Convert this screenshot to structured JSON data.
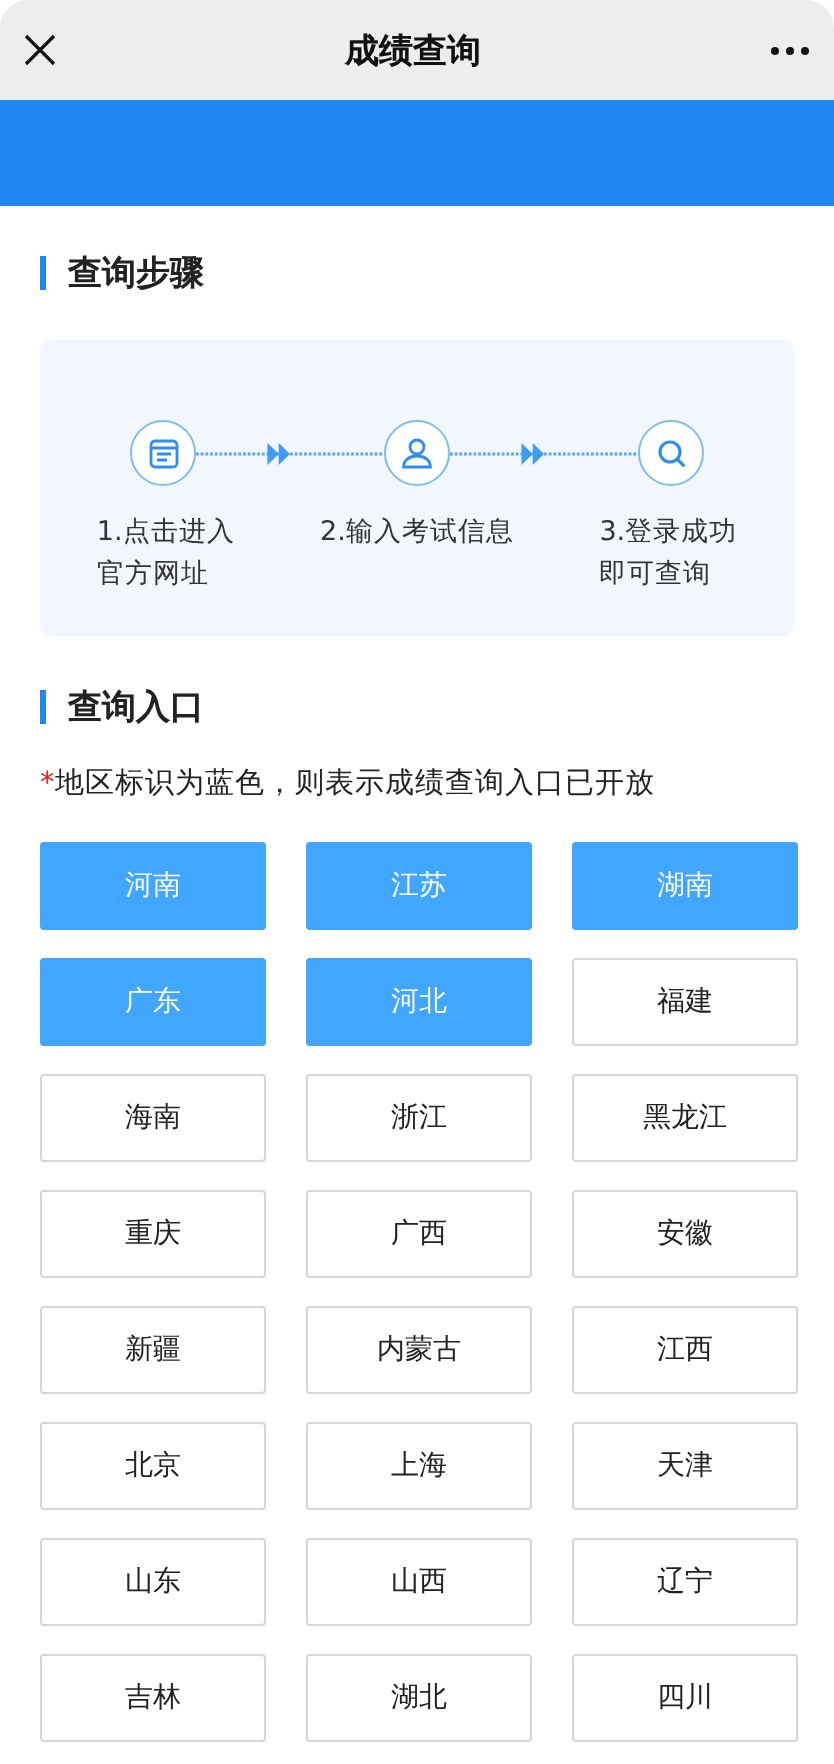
{
  "nav_bar": {
    "title": "成绩查询"
  },
  "steps_section": {
    "title": "查询步骤",
    "steps": [
      {
        "kind": "page",
        "lines": [
          "1.点击进入",
          "官方网址"
        ]
      },
      {
        "kind": "user",
        "lines": [
          "2.输入考试信息"
        ]
      },
      {
        "kind": "search",
        "lines": [
          "3.登录成功",
          "即可查询"
        ]
      }
    ]
  },
  "entry_section": {
    "title": "查询入口",
    "note": {
      "marker": "*",
      "text": "地区标识为蓝色，则表示成绩查询入口已开放"
    },
    "regions": [
      {
        "label": "河南",
        "open": true
      },
      {
        "label": "江苏",
        "open": true
      },
      {
        "label": "湖南",
        "open": true
      },
      {
        "label": "广东",
        "open": true
      },
      {
        "label": "河北",
        "open": true
      },
      {
        "label": "福建",
        "open": false
      },
      {
        "label": "海南",
        "open": false
      },
      {
        "label": "浙江",
        "open": false
      },
      {
        "label": "黑龙江",
        "open": false
      },
      {
        "label": "重庆",
        "open": false
      },
      {
        "label": "广西",
        "open": false
      },
      {
        "label": "安徽",
        "open": false
      },
      {
        "label": "新疆",
        "open": false
      },
      {
        "label": "内蒙古",
        "open": false
      },
      {
        "label": "江西",
        "open": false
      },
      {
        "label": "北京",
        "open": false
      },
      {
        "label": "上海",
        "open": false
      },
      {
        "label": "天津",
        "open": false
      },
      {
        "label": "山东",
        "open": false
      },
      {
        "label": "山西",
        "open": false
      },
      {
        "label": "辽宁",
        "open": false
      },
      {
        "label": "吉林",
        "open": false
      },
      {
        "label": "湖北",
        "open": false
      },
      {
        "label": "四川",
        "open": false
      }
    ]
  }
}
